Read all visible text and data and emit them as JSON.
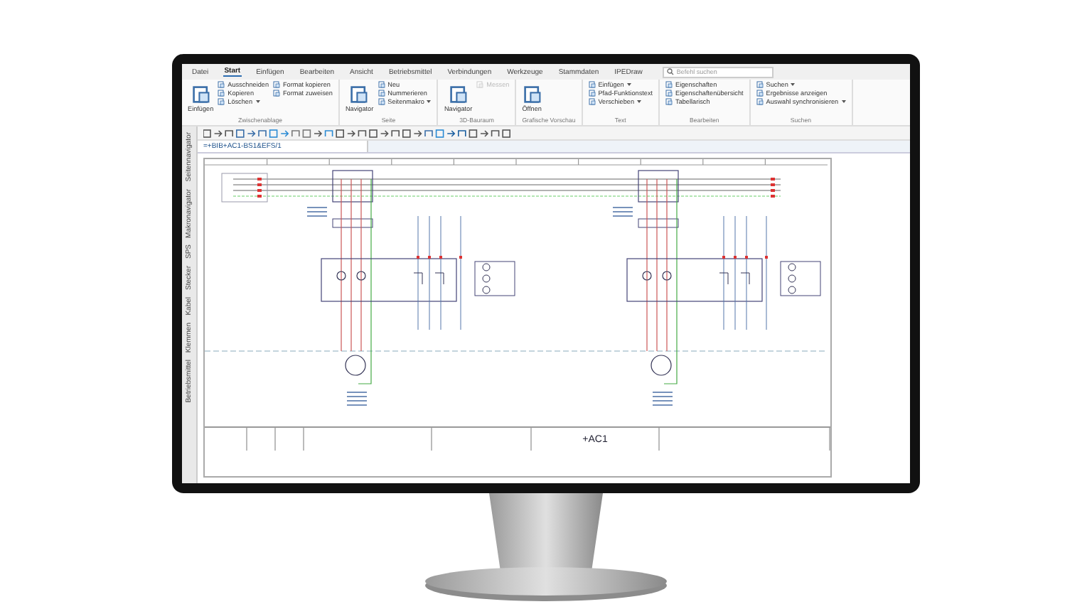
{
  "tabs": [
    {
      "label": "Datei",
      "selected": false
    },
    {
      "label": "Start",
      "selected": true
    },
    {
      "label": "Einfügen",
      "selected": false
    },
    {
      "label": "Bearbeiten",
      "selected": false
    },
    {
      "label": "Ansicht",
      "selected": false
    },
    {
      "label": "Betriebsmittel",
      "selected": false
    },
    {
      "label": "Verbindungen",
      "selected": false
    },
    {
      "label": "Werkzeuge",
      "selected": false
    },
    {
      "label": "Stammdaten",
      "selected": false
    },
    {
      "label": "IPEDraw",
      "selected": false
    }
  ],
  "search": {
    "placeholder": "Befehl suchen"
  },
  "groups": [
    {
      "title": "Zwischenablage",
      "items": [
        {
          "label": "Einfügen",
          "kind": "large",
          "dropdown": false,
          "disabled": false
        },
        {
          "label": "Ausschneiden",
          "kind": "small",
          "dropdown": false,
          "disabled": false
        },
        {
          "label": "Kopieren",
          "kind": "small",
          "dropdown": false,
          "disabled": false
        },
        {
          "label": "Löschen",
          "kind": "small",
          "dropdown": true,
          "disabled": false
        },
        {
          "label": "Format kopieren",
          "kind": "small",
          "dropdown": false,
          "disabled": false
        },
        {
          "label": "Format zuweisen",
          "kind": "small",
          "dropdown": false,
          "disabled": false
        }
      ]
    },
    {
      "title": "Seite",
      "items": [
        {
          "label": "Navigator",
          "kind": "large",
          "dropdown": false,
          "disabled": false
        },
        {
          "label": "Neu",
          "kind": "small",
          "dropdown": false,
          "disabled": false
        },
        {
          "label": "Nummerieren",
          "kind": "small",
          "dropdown": false,
          "disabled": false
        },
        {
          "label": "Seitenmakro",
          "kind": "small",
          "dropdown": true,
          "disabled": false
        }
      ]
    },
    {
      "title": "3D-Bauraum",
      "items": [
        {
          "label": "Navigator",
          "kind": "large",
          "dropdown": false,
          "disabled": false
        },
        {
          "label": "Messen",
          "kind": "small",
          "dropdown": false,
          "disabled": true
        }
      ]
    },
    {
      "title": "Grafische Vorschau",
      "items": [
        {
          "label": "Öffnen",
          "kind": "large",
          "dropdown": false,
          "disabled": false
        }
      ]
    },
    {
      "title": "Text",
      "items": [
        {
          "label": "Einfügen",
          "kind": "small",
          "dropdown": true,
          "disabled": false
        },
        {
          "label": "Pfad-Funktionstext",
          "kind": "small",
          "dropdown": false,
          "disabled": false
        },
        {
          "label": "Verschieben",
          "kind": "small",
          "dropdown": true,
          "disabled": false
        }
      ]
    },
    {
      "title": "Bearbeiten",
      "items": [
        {
          "label": "Eigenschaften",
          "kind": "small",
          "dropdown": false,
          "disabled": false
        },
        {
          "label": "Eigenschaftenübersicht",
          "kind": "small",
          "dropdown": false,
          "disabled": false
        },
        {
          "label": "Tabellarisch",
          "kind": "small",
          "dropdown": false,
          "disabled": false
        }
      ]
    },
    {
      "title": "Suchen",
      "items": [
        {
          "label": "Suchen",
          "kind": "small",
          "dropdown": true,
          "disabled": false
        },
        {
          "label": "Ergebnisse anzeigen",
          "kind": "small",
          "dropdown": false,
          "disabled": false
        },
        {
          "label": "Auswahl synchronisieren",
          "kind": "small",
          "dropdown": true,
          "disabled": false
        }
      ]
    }
  ],
  "doc_tab": {
    "label": "=+BIB+AC1-BS1&EFS/1"
  },
  "sidebar": {
    "items": [
      {
        "label": "Seitennavigator"
      },
      {
        "label": "Makronavigator"
      },
      {
        "label": "SPS"
      },
      {
        "label": "Stecker"
      },
      {
        "label": "Kabel"
      },
      {
        "label": "Klemmen"
      },
      {
        "label": "Betriebsmittel"
      }
    ]
  },
  "title_block": {
    "location": "+AC1"
  }
}
